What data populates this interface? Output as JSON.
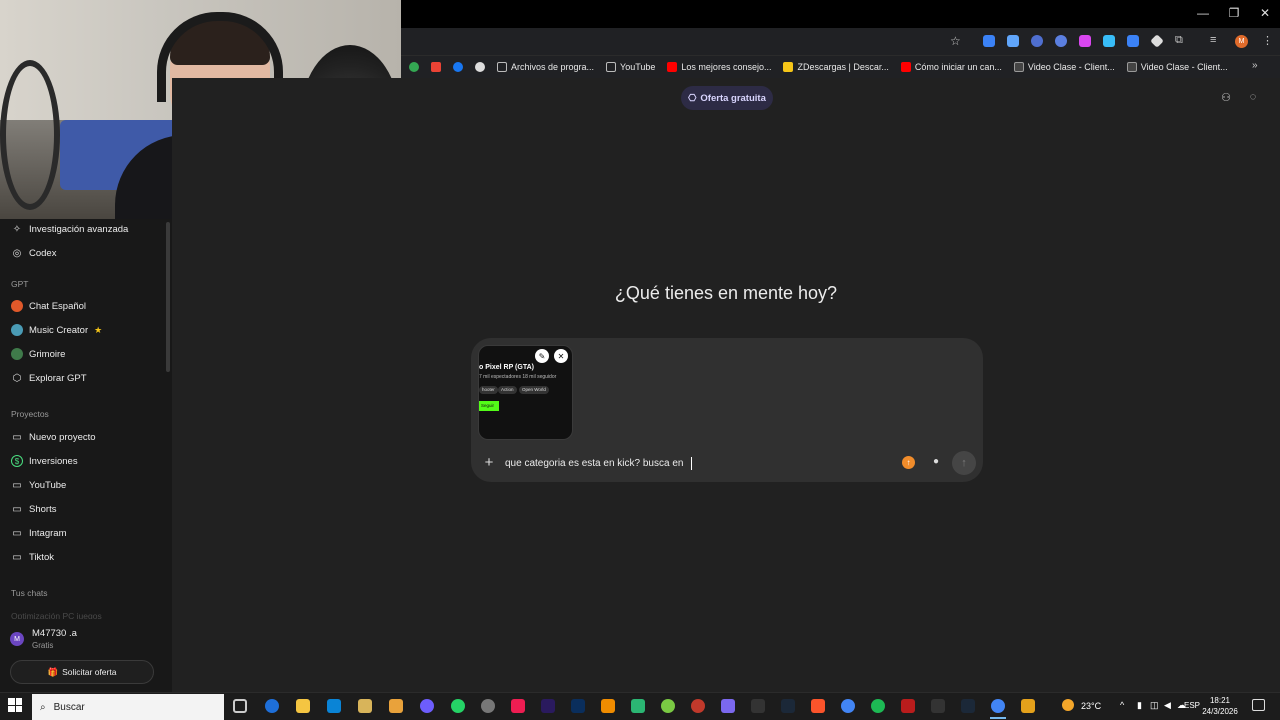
{
  "browser": {
    "bookmarks": [
      {
        "label": "Archivos de progra...",
        "icon": "folder-icon"
      },
      {
        "label": "YouTube",
        "icon": "folder-icon"
      },
      {
        "label": "Los mejores consejo...",
        "icon": "youtube-icon"
      },
      {
        "label": "ZDescargas | Descar...",
        "icon": "z-icon"
      },
      {
        "label": "Cómo iniciar un can...",
        "icon": "youtube-icon"
      },
      {
        "label": "Video Clase - Client...",
        "icon": "cc-icon"
      },
      {
        "label": "Video Clase - Client...",
        "icon": "cc-icon"
      }
    ],
    "more_bookmarks": "»",
    "window_controls": {
      "minimize": "—",
      "restore": "❐",
      "close": "✕"
    }
  },
  "sidebar": {
    "top_items": [
      {
        "label": "Investigación avanzada",
        "icon": "telescope-icon"
      },
      {
        "label": "Codex",
        "icon": "codex-icon"
      }
    ],
    "gpt_header": "GPT",
    "gpt_items": [
      {
        "label": "Chat Español",
        "icon": "chat-espanol-icon"
      },
      {
        "label": "Music Creator",
        "icon": "music-creator-icon",
        "badge": "★"
      },
      {
        "label": "Grimoire",
        "icon": "grimoire-icon"
      },
      {
        "label": "Explorar GPT",
        "icon": "explore-icon"
      }
    ],
    "projects_header": "Proyectos",
    "project_items": [
      {
        "label": "Nuevo proyecto",
        "icon": "new-folder-icon"
      },
      {
        "label": "Inversiones",
        "icon": "dollar-icon"
      },
      {
        "label": "YouTube",
        "icon": "folder-icon"
      },
      {
        "label": "Shorts",
        "icon": "folder-icon"
      },
      {
        "label": "Intagram",
        "icon": "folder-icon"
      },
      {
        "label": "Tiktok",
        "icon": "folder-icon"
      }
    ],
    "chats_header": "Tus chats",
    "faded_chat": "Optimización PC juegos",
    "user": {
      "name": "M47730 .a",
      "plan": "Gratis",
      "initial": "M"
    },
    "offer_button": "Solicitar oferta"
  },
  "main": {
    "promo": "Oferta gratuita",
    "headline": "¿Qué tienes en mente hoy?",
    "attachment": {
      "title": "o Pixel RP (GTA)",
      "stats": "7 mil espectadores  18 mil seguidor",
      "tags": [
        "hooter",
        "Action",
        "Open World"
      ],
      "follow": "Seguir",
      "edit_icon": "✎",
      "remove_icon": "✕"
    },
    "prompt_text": "que categoria es esta en kick? busca en",
    "plus": "+",
    "send": "↑",
    "mic": "🎙"
  },
  "taskbar": {
    "search_placeholder": "Buscar",
    "weather": "23°C",
    "language": "ESP",
    "time": "18:21",
    "date": "24/3/2026"
  },
  "colors": {
    "background": "#212121",
    "sidebar": "#181818",
    "composer": "#303030",
    "accent_kick": "#53fc18",
    "promo": "#2d2b45"
  }
}
